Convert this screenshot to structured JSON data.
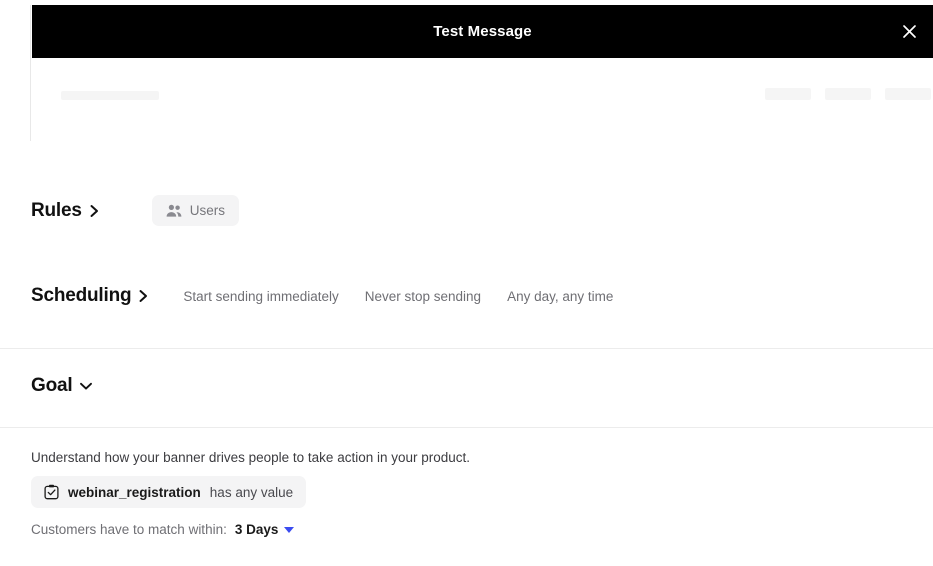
{
  "preview": {
    "title": "Test Message",
    "close_icon": "close-icon",
    "skeleton_bars": 4
  },
  "sections": {
    "rules": {
      "title": "Rules",
      "chevron": "chevron-right-icon",
      "chip": {
        "icon": "users-icon",
        "label": "Users"
      }
    },
    "scheduling": {
      "title": "Scheduling",
      "chevron": "chevron-right-icon",
      "summaries": [
        "Start sending immediately",
        "Never stop sending",
        "Any day, any time"
      ]
    },
    "goal": {
      "title": "Goal",
      "chevron": "chevron-down-icon",
      "description": "Understand how your banner drives people to take action in your product.",
      "event": {
        "icon": "task-checkbox-icon",
        "name": "webinar_registration",
        "condition": "has any value"
      },
      "match_label": "Customers have to match within:",
      "match_value": "3 Days",
      "match_caret": "caret-down-icon"
    }
  },
  "colors": {
    "banner_bg": "#000000",
    "banner_text": "#ffffff",
    "chip_bg": "#f4f4f5",
    "muted_text": "#6f6f74",
    "accent": "#3b4cf0",
    "divider": "#ececec",
    "skeleton": "#f5f5f5"
  }
}
